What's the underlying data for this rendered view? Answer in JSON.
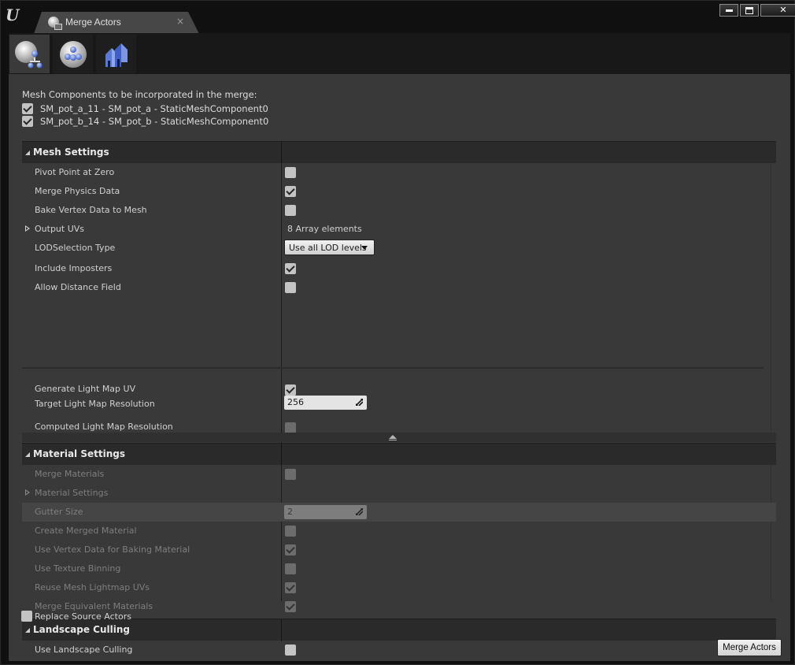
{
  "window": {
    "tab_title": "Merge Actors",
    "tab_close": "×",
    "logo_text": "U",
    "controls": [
      "minimize-icon",
      "maximize-icon",
      "close-icon"
    ],
    "close_glyph": "✕"
  },
  "mode_tabs": [
    {
      "name": "merge-actors-mode",
      "icon": "spheres-merge-icon",
      "active": true
    },
    {
      "name": "proxy-mesh-mode",
      "icon": "sphere-cluster-icon",
      "active": false
    },
    {
      "name": "instancing-mode",
      "icon": "blue-houses-icon",
      "active": false
    }
  ],
  "components": {
    "label": "Mesh Components to be incorporated in the merge:",
    "items": [
      {
        "text": "SM_pot_a_11 - SM_pot_a - StaticMeshComponent0",
        "checked": true
      },
      {
        "text": "SM_pot_b_14 - SM_pot_b - StaticMeshComponent0",
        "checked": true
      }
    ]
  },
  "mesh_settings": {
    "title": "Mesh Settings",
    "pivot_point_at_zero": {
      "label": "Pivot Point at Zero",
      "checked": false
    },
    "merge_physics_data": {
      "label": "Merge Physics Data",
      "checked": true
    },
    "bake_vertex_data": {
      "label": "Bake Vertex Data to Mesh",
      "checked": false
    },
    "output_uvs": {
      "label": "Output UVs",
      "value": "8 Array elements"
    },
    "lod_selection_type": {
      "label": "LODSelection Type",
      "value": "Use all LOD levels"
    },
    "include_imposters": {
      "label": "Include Imposters",
      "checked": true
    },
    "allow_distance_field": {
      "label": "Allow Distance Field",
      "checked": false
    },
    "generate_light_map_uv": {
      "label": "Generate Light Map UV",
      "checked": true
    },
    "target_light_map_resolution": {
      "label": "Target Light Map Resolution",
      "value": "256"
    },
    "computed_light_map_resolution": {
      "label": "Computed Light Map Resolution",
      "checked": false
    }
  },
  "material_settings": {
    "title": "Material Settings",
    "merge_materials": {
      "label": "Merge Materials",
      "checked": false
    },
    "material_settings_group": {
      "label": "Material Settings"
    },
    "gutter_size": {
      "label": "Gutter Size",
      "value": "2"
    },
    "create_merged_material": {
      "label": "Create Merged Material",
      "checked": false
    },
    "use_vertex_data": {
      "label": "Use Vertex Data for Baking Material",
      "checked": true
    },
    "use_texture_binning": {
      "label": "Use Texture Binning",
      "checked": false
    },
    "reuse_mesh_lightmap_uvs": {
      "label": "Reuse Mesh Lightmap UVs",
      "checked": true
    },
    "merge_equivalent_materials": {
      "label": "Merge Equivalent Materials",
      "checked": true
    }
  },
  "landscape_culling": {
    "title": "Landscape Culling",
    "use_landscape_culling": {
      "label": "Use Landscape Culling",
      "checked": false
    }
  },
  "replace_source_actors": {
    "label": "Replace Source Actors",
    "checked": false
  },
  "merge_button": {
    "label": "Merge Actors"
  }
}
